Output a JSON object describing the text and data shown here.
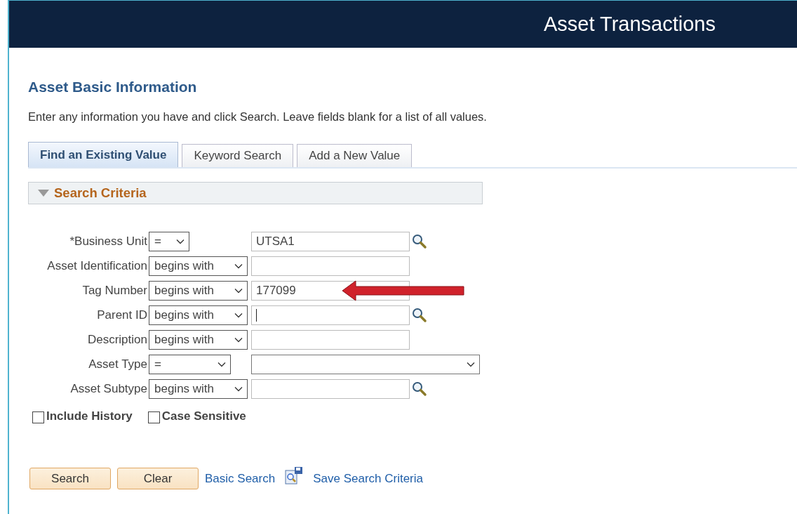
{
  "header": {
    "title": "Asset Transactions"
  },
  "page": {
    "title": "Asset Basic Information",
    "instructions": "Enter any information you have and click Search. Leave fields blank for a list of all values."
  },
  "tabs": [
    {
      "label": "Find an Existing Value",
      "selected": true
    },
    {
      "label": "Keyword Search",
      "selected": false
    },
    {
      "label": "Add a New Value",
      "selected": false
    }
  ],
  "section": {
    "title": "Search Criteria",
    "expanded": true
  },
  "criteria": [
    {
      "label": "*Business Unit",
      "operator": "=",
      "kind": "text",
      "value": "UTSA1",
      "lookup": true,
      "focused": false
    },
    {
      "label": "Asset Identification",
      "operator": "begins with",
      "kind": "text",
      "lookup": false,
      "focused": false
    },
    {
      "label": "Tag Number",
      "operator": "begins with",
      "kind": "text",
      "value": "177099",
      "lookup": false,
      "focused": false,
      "highlighted": true
    },
    {
      "label": "Parent ID",
      "operator": "begins with",
      "kind": "text",
      "lookup": true,
      "focused": true
    },
    {
      "label": "Description",
      "operator": "begins with",
      "kind": "text",
      "lookup": false,
      "focused": false
    },
    {
      "label": "Asset Type",
      "operator": "=",
      "kind": "select",
      "lookup": false,
      "focused": false
    },
    {
      "label": "Asset Subtype",
      "operator": "begins with",
      "kind": "text",
      "lookup": true,
      "focused": false
    }
  ],
  "options": [
    {
      "label": "Include History",
      "checked": false
    },
    {
      "label": "Case Sensitive",
      "checked": false
    }
  ],
  "buttons": [
    "Search",
    "Clear"
  ],
  "links": [
    {
      "label": "Basic Search",
      "icon": false
    },
    {
      "label": "Save Search Criteria",
      "icon": true
    }
  ]
}
